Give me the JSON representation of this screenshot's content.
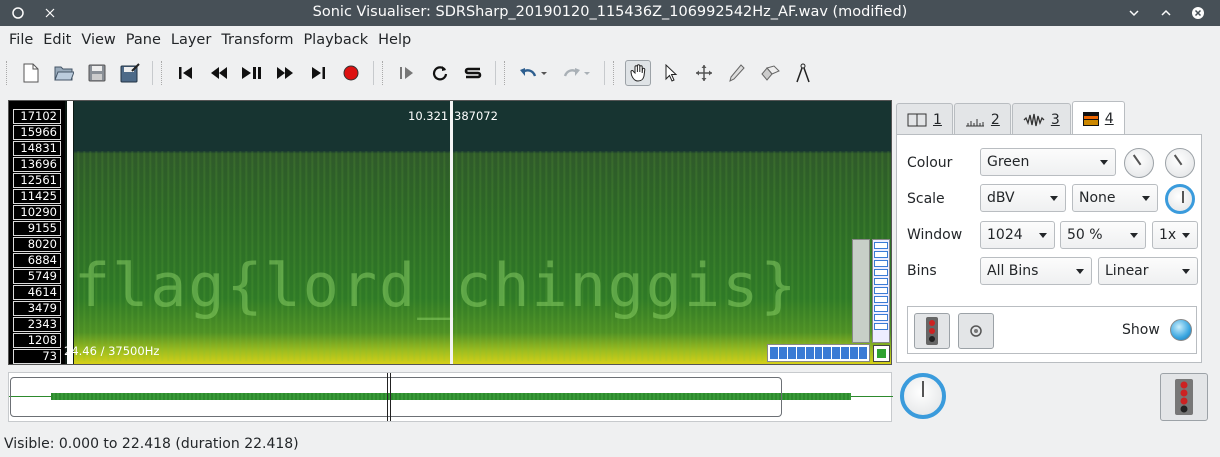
{
  "window": {
    "title": "Sonic Visualiser: SDRSharp_20190120_115436Z_106992542Hz_AF.wav (modified)",
    "icons": [
      "pin-icon",
      "menu-icon",
      "close-icon"
    ]
  },
  "menubar": {
    "items": [
      "File",
      "Edit",
      "View",
      "Pane",
      "Layer",
      "Transform",
      "Playback",
      "Help"
    ],
    "mnemonics": [
      "F",
      "E",
      "V",
      "P",
      "L",
      "T",
      "b",
      "H"
    ]
  },
  "toolbar": {
    "file": [
      "new-icon",
      "open-icon",
      "save-icon",
      "save-as-icon"
    ],
    "transport": [
      "rewind-start-icon",
      "rewind-icon",
      "play-pause-icon",
      "fast-forward-icon",
      "ffwd-end-icon",
      "record-icon"
    ],
    "play_modes": [
      "play-selection-icon",
      "loop-icon",
      "solo-icon"
    ],
    "edit": [
      "undo-icon",
      "redo-icon"
    ],
    "tools": [
      "navigate-icon",
      "select-icon",
      "move-icon",
      "draw-icon",
      "erase-icon",
      "measure-icon"
    ],
    "active_tool": "navigate-icon"
  },
  "pane": {
    "frequency_scale": [
      "17102",
      "15966",
      "14831",
      "13696",
      "12561",
      "11425",
      "10290",
      "9155",
      "8020",
      "6884",
      "5749",
      "4614",
      "3479",
      "2343",
      "1208",
      "73"
    ],
    "time_readout": "10.321",
    "frame_readout": "387072",
    "freq_readout": "24.46 / 37500Hz",
    "hidden_text": "flag{lord_chinggis}"
  },
  "property_panel": {
    "tabs": [
      {
        "icon": "pane-icon",
        "label": "1"
      },
      {
        "icon": "ruler-icon",
        "label": "2"
      },
      {
        "icon": "waveform-icon",
        "label": "3"
      },
      {
        "icon": "spectrogram-icon",
        "label": "4"
      }
    ],
    "active_tab": 3,
    "colour": {
      "label": "Colour",
      "value": "Green"
    },
    "scale": {
      "label": "Scale",
      "value": "dBV",
      "normalize": "None"
    },
    "window": {
      "label": "Window",
      "size": "1024",
      "overlap": "50 %",
      "oversampling": "1x"
    },
    "bins": {
      "label": "Bins",
      "mode": "All Bins",
      "scale": "Linear"
    },
    "show_label": "Show"
  },
  "status": {
    "text": "Visible: 0.000 to 22.418 (duration 22.418)"
  },
  "colors": {
    "accent": "#3a9bdc",
    "waveform": "#2d8a2d",
    "titlebar": "#475057"
  }
}
